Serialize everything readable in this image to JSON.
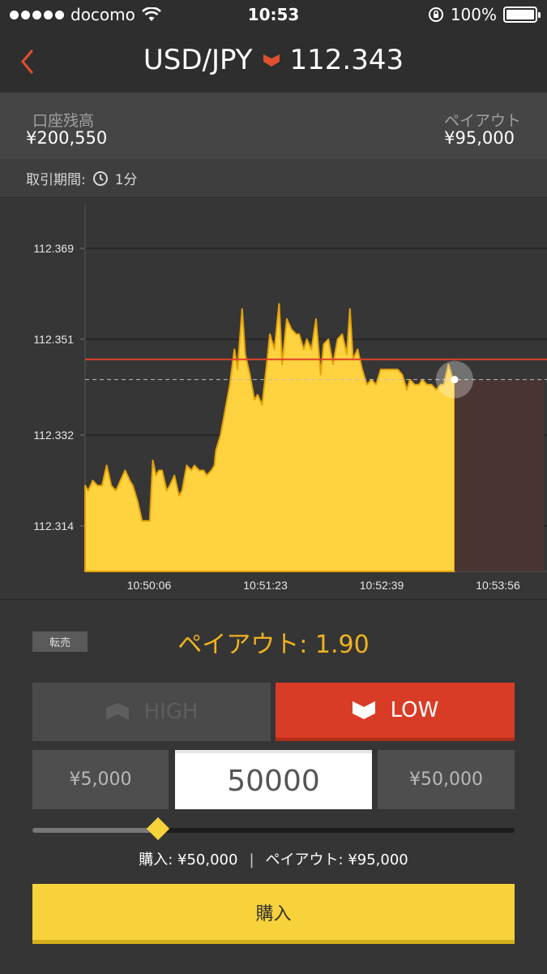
{
  "status_bar": {
    "carrier": "docomo",
    "time": "10:53",
    "battery": "100%"
  },
  "header": {
    "pair": "USD/JPY",
    "price": "112.343",
    "accent_color": "#e0502e"
  },
  "account": {
    "balance_label": "口座残高",
    "balance_value": "¥200,550",
    "payout_label": "ペイアウト",
    "payout_value": "¥95,000"
  },
  "period": {
    "label": "取引期間:",
    "value": "1分"
  },
  "chart_data": {
    "type": "area",
    "y_ticks": [
      "112.369",
      "112.351",
      "112.332",
      "112.314"
    ],
    "x_ticks": [
      "10:50:06",
      "10:51:23",
      "10:52:39",
      "10:53:56"
    ],
    "ylim": [
      112.305,
      112.378
    ],
    "xlim_seconds": [
      0,
      300
    ],
    "strike_rate": 112.347,
    "current_rate": 112.343,
    "x": [
      0,
      2,
      5,
      8,
      11,
      14,
      17,
      20,
      23,
      26,
      29,
      31,
      34,
      37,
      39,
      42,
      44,
      46,
      48,
      50,
      53,
      55,
      58,
      61,
      63,
      66,
      69,
      71,
      74,
      77,
      79,
      82,
      84,
      85,
      88,
      91,
      94,
      97,
      99,
      102,
      104,
      107,
      110,
      112,
      115,
      118,
      120,
      123,
      126,
      128,
      131,
      134,
      137,
      139,
      142,
      144,
      147,
      150,
      153,
      155,
      158,
      161,
      164,
      167,
      170,
      172,
      174,
      177,
      180,
      183,
      186,
      189,
      192,
      194,
      197,
      200,
      203,
      206,
      209,
      211,
      214,
      217,
      219,
      222,
      225,
      228,
      231,
      233,
      236,
      239,
      240
    ],
    "y": [
      112.322,
      112.321,
      112.323,
      112.322,
      112.322,
      112.326,
      112.322,
      112.321,
      112.323,
      112.325,
      112.323,
      112.322,
      112.319,
      112.315,
      112.315,
      112.315,
      112.327,
      112.324,
      112.325,
      112.325,
      112.321,
      112.322,
      112.324,
      112.32,
      112.321,
      112.326,
      112.325,
      112.326,
      112.325,
      112.325,
      112.324,
      112.325,
      112.326,
      112.329,
      112.332,
      112.337,
      112.342,
      112.349,
      112.345,
      112.357,
      112.348,
      112.344,
      112.339,
      112.34,
      112.338,
      112.346,
      112.352,
      112.349,
      112.358,
      112.346,
      112.355,
      112.353,
      112.352,
      112.352,
      112.349,
      112.351,
      112.349,
      112.355,
      112.344,
      112.35,
      112.351,
      112.346,
      112.351,
      112.352,
      112.348,
      112.357,
      112.347,
      112.349,
      112.345,
      112.342,
      112.343,
      112.342,
      112.345,
      112.345,
      112.345,
      112.345,
      112.345,
      112.344,
      112.341,
      112.343,
      112.342,
      112.342,
      112.343,
      112.342,
      112.342,
      112.341,
      112.342,
      112.342,
      112.346,
      112.343,
      112.343
    ],
    "fill_color": "#ffd23f",
    "expiry_band_color": "#4a3432",
    "strike_color": "#e0402a"
  },
  "trade": {
    "resell_label": "転売",
    "payout_rate": "ペイアウト: 1.90",
    "high_label": "HIGH",
    "low_label": "LOW",
    "amount_min": "¥5,000",
    "amount_value": "50000",
    "amount_max": "¥50,000",
    "slider_fraction": 0.26,
    "purchase_summary": "購入: ¥50,000",
    "payout_summary": "ペイアウト: ¥95,000",
    "separator": "|",
    "buy_label": "購入"
  }
}
